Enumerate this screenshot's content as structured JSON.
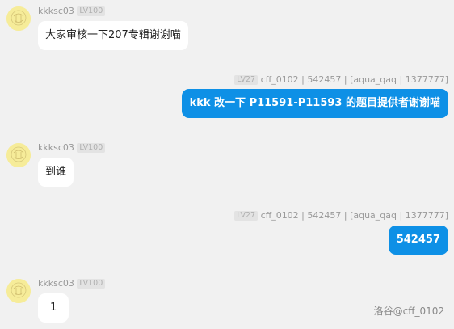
{
  "messages": [
    {
      "side": "left",
      "sender": "kkksc03",
      "level": "LV100",
      "text": "大家审核一下207专辑谢谢喵"
    },
    {
      "side": "right",
      "sender": "cff_0102 | 542457 | [aqua_qaq | 1377777]",
      "level": "LV27",
      "text": "kkk 改一下 P11591-P11593 的题目提供者谢谢喵"
    },
    {
      "side": "left",
      "sender": "kkksc03",
      "level": "LV100",
      "text": "到谁"
    },
    {
      "side": "right",
      "sender": "cff_0102 | 542457 | [aqua_qaq | 1377777]",
      "level": "LV27",
      "text": "542457"
    },
    {
      "side": "left",
      "sender": "kkksc03",
      "level": "LV100",
      "text": "1"
    }
  ],
  "watermark": "洛谷@cff_0102",
  "colors": {
    "background": "#f1f1f1",
    "right_bubble": "#0e90e6",
    "left_bubble": "#ffffff",
    "avatar": "#f6ec99"
  },
  "icons": {
    "avatar": "user-avatar-icon"
  }
}
